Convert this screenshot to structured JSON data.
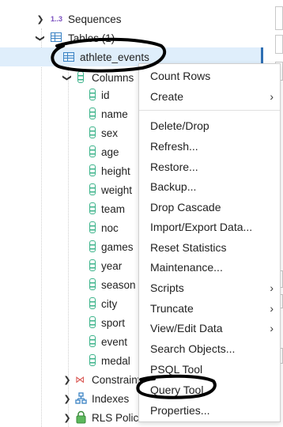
{
  "tree": {
    "sequences": {
      "prefix": "1..3",
      "label": "Sequences"
    },
    "tables": {
      "label": "Tables (1)"
    },
    "selected_table": {
      "label": "athlete_events"
    },
    "columns_group": {
      "label": "Columns"
    },
    "columns": [
      "id",
      "name",
      "sex",
      "age",
      "height",
      "weight",
      "team",
      "noc",
      "games",
      "year",
      "season",
      "city",
      "sport",
      "event",
      "medal"
    ],
    "constraints": {
      "label": "Constraints"
    },
    "indexes": {
      "label": "Indexes"
    },
    "rls": {
      "label": "RLS Policies"
    }
  },
  "context_menu": {
    "group1": [
      {
        "label": "Count Rows",
        "submenu": false
      },
      {
        "label": "Create",
        "submenu": true
      }
    ],
    "group2": [
      {
        "label": "Delete/Drop",
        "submenu": false
      },
      {
        "label": "Refresh...",
        "submenu": false
      },
      {
        "label": "Restore...",
        "submenu": false
      },
      {
        "label": "Backup...",
        "submenu": false
      },
      {
        "label": "Drop Cascade",
        "submenu": false
      },
      {
        "label": "Import/Export Data...",
        "submenu": false
      },
      {
        "label": "Reset Statistics",
        "submenu": false
      },
      {
        "label": "Maintenance...",
        "submenu": false
      },
      {
        "label": "Scripts",
        "submenu": true
      },
      {
        "label": "Truncate",
        "submenu": true
      },
      {
        "label": "View/Edit Data",
        "submenu": true
      },
      {
        "label": "Search Objects...",
        "submenu": false
      },
      {
        "label": "PSQL Tool",
        "submenu": false
      },
      {
        "label": "Query Tool",
        "submenu": false
      },
      {
        "label": "Properties...",
        "submenu": false
      }
    ]
  },
  "colors": {
    "selected_bg": "#dfeefb",
    "accent": "#2f6fb3",
    "column_icon": "#3bb38a",
    "annotation": "#000000"
  }
}
